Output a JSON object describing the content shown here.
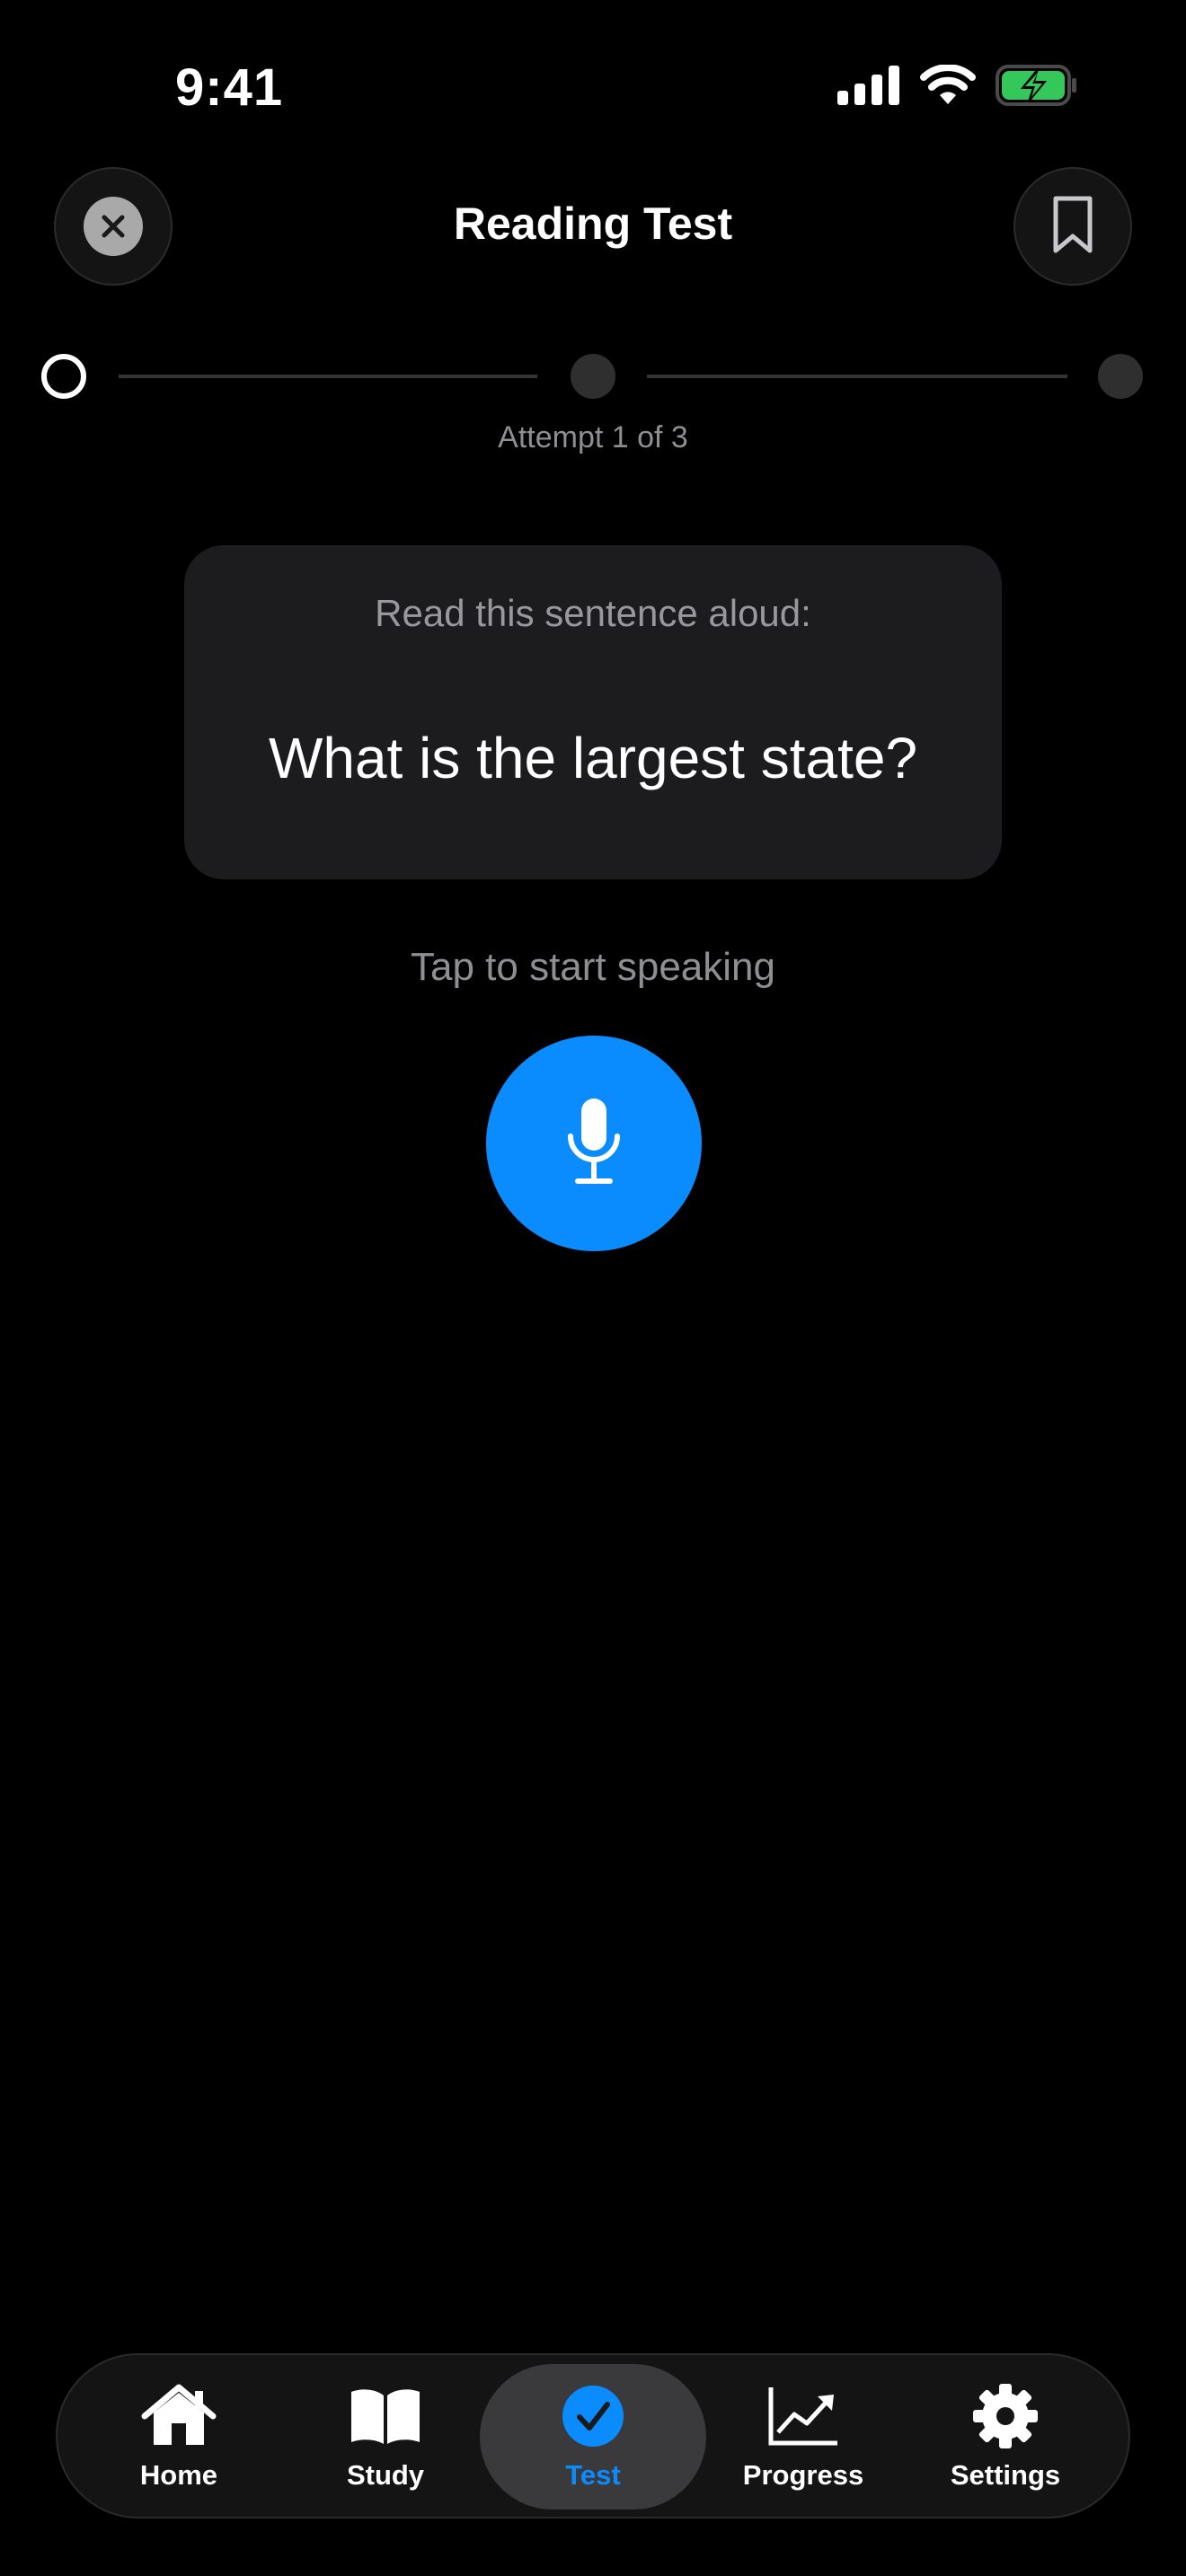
{
  "status_bar": {
    "time": "9:41",
    "battery_color": "#34c759"
  },
  "header": {
    "title": "Reading Test",
    "close_icon": "close-icon",
    "bookmark_icon": "bookmark-icon"
  },
  "progress": {
    "current_step": 1,
    "total_steps": 3,
    "attempt_text": "Attempt 1 of 3"
  },
  "card": {
    "prompt": "Read this sentence aloud:",
    "sentence": "What is the largest state?"
  },
  "speech": {
    "hint": "Tap to start speaking",
    "button_icon": "microphone-icon",
    "accent": "#0a8cff"
  },
  "tabs": [
    {
      "label": "Home",
      "icon": "home-icon"
    },
    {
      "label": "Study",
      "icon": "book-icon"
    },
    {
      "label": "Test",
      "icon": "checkmark-circle-icon",
      "selected": true
    },
    {
      "label": "Progress",
      "icon": "chart-line-icon"
    },
    {
      "label": "Settings",
      "icon": "gear-icon"
    }
  ]
}
